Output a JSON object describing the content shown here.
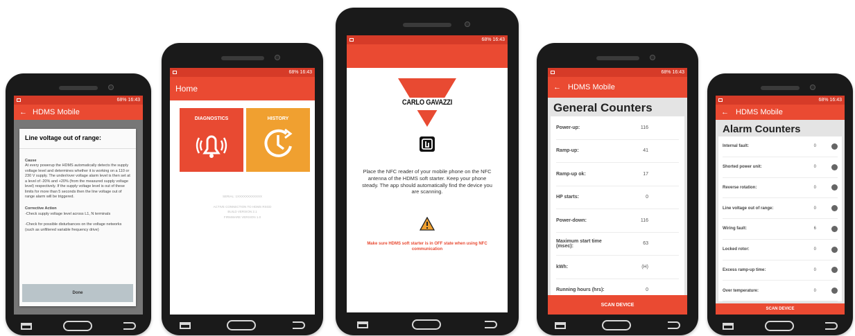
{
  "status": {
    "time": "16:43",
    "battery": "68%"
  },
  "app_title": "HDMS Mobile",
  "alert": {
    "title": "Line voltage out of range:",
    "cause_heading": "Cause",
    "cause_text": "At every powerup the HDMS automatically detects the supply voltage level and determines whether it is working on a 110 or 230 V supply. The under/over voltage alarm level is then set at a level of -20% and +20% (from the measured supply voltage level) respectively. If the supply voltage level is out of these limits for more than 5 seconds then the line voltage out of range alarm will be triggered.",
    "action_heading": "Corrective Action",
    "action_1": "-Check supply voltage level across L1, N terminals",
    "action_2": "-Check for possible disturbances on the voltage networks (such as unfiltered variable frequency drive)",
    "done_label": "Done"
  },
  "home": {
    "title": "Home",
    "diagnostics_label": "DIAGNOSTICS",
    "history_label": "HISTORY",
    "footer_line1": "SERIAL: 1XXXXXXXXXXXX",
    "footer_line2": "ACTIVE CONNECTION TO HDMS RSGD",
    "footer_line3": "BUILD VERSION 2.1",
    "footer_line4": "FIRMWARE VERSION 1.0"
  },
  "nfc": {
    "brand": "CARLO GAVAZZI",
    "instruction": "Place the NFC reader of your mobile phone on the NFC antenna of the HDMS soft starter. Keep your phone steady. The app should automatically find the device you are scanning.",
    "warning": "Make sure HDMS soft starter is in OFF state when using NFC communication"
  },
  "general": {
    "heading": "General Counters",
    "rows": [
      {
        "label": "Power-up:",
        "value": "116"
      },
      {
        "label": "Ramp-up:",
        "value": "41"
      },
      {
        "label": "Ramp-up ok:",
        "value": "17"
      },
      {
        "label": "HP starts:",
        "value": "0"
      },
      {
        "label": "Power-down:",
        "value": "116"
      },
      {
        "label": "Maximum start time (msec):",
        "value": "63"
      },
      {
        "label": "kWh:",
        "value": "(H)"
      },
      {
        "label": "Running hours (hrs):",
        "value": "0"
      }
    ],
    "scan_label": "SCAN DEVICE"
  },
  "alarm": {
    "heading": "Alarm Counters",
    "rows": [
      {
        "label": "Internal fault:",
        "value": "0"
      },
      {
        "label": "Shorted power unit:",
        "value": "0"
      },
      {
        "label": "Reverse rotation:",
        "value": "0"
      },
      {
        "label": "Line voltage out of range:",
        "value": "0"
      },
      {
        "label": "Wiring fault:",
        "value": "6"
      },
      {
        "label": "Locked rotor:",
        "value": "0"
      },
      {
        "label": "Excess ramp-up time:",
        "value": "0"
      },
      {
        "label": "Over temperature:",
        "value": "0"
      }
    ],
    "scan_label": "SCAN DEVICE"
  },
  "colors": {
    "accent": "#ea4a32",
    "orange": "#f0a030",
    "dark": "#1a1a1a"
  },
  "icons": [
    "back-arrow-icon",
    "bell-icon",
    "clock-icon",
    "nfc-icon",
    "warning-icon",
    "info-icon"
  ]
}
